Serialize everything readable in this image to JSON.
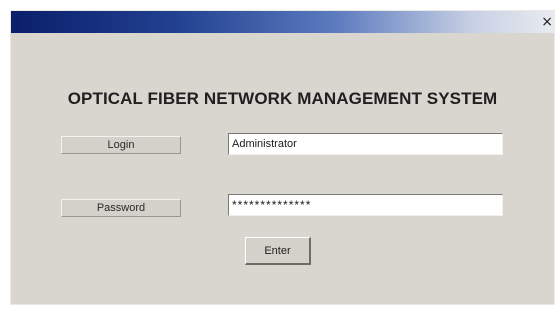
{
  "window": {
    "close_glyph": "×",
    "title_bar_colors": [
      "#0a1f6b",
      "#c7d0e4"
    ]
  },
  "app": {
    "title": "OPTICAL FIBER NETWORK MANAGEMENT SYSTEM"
  },
  "form": {
    "login_label": "Login",
    "login_value": "Administrator",
    "password_label": "Password",
    "password_value": "**************",
    "enter_label": "Enter"
  }
}
